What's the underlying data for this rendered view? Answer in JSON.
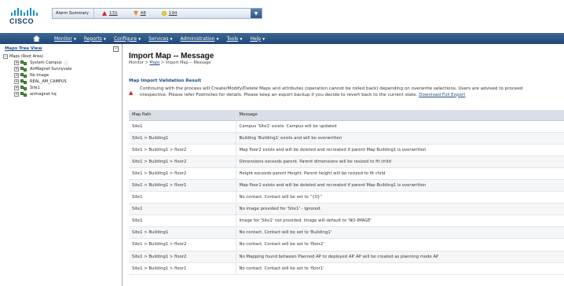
{
  "header": {
    "logo_text": "CISCO",
    "alarm_summary": {
      "label": "Alarm Summary",
      "critical": "131",
      "major": "48",
      "minor": "194"
    }
  },
  "menu": {
    "items": [
      "Monitor",
      "Reports",
      "Configure",
      "Services",
      "Administration",
      "Tools",
      "Help"
    ]
  },
  "sidebar": {
    "title": "Maps Tree View",
    "collapse": "−",
    "root": "Maps (Root Area)",
    "items": [
      {
        "label": "System Campus"
      },
      {
        "label": "AirMagnet Sunnyvale"
      },
      {
        "label": "No Image"
      },
      {
        "label": "REAL_AM_CAMPUS"
      },
      {
        "label": "Site1"
      },
      {
        "label": "airmagnet hq"
      }
    ]
  },
  "main": {
    "title": "Import Map -- Message",
    "breadcrumb": {
      "prefix": "Monitor > ",
      "link": "Maps",
      "suffix": " > Import Map -- Message"
    },
    "section_title": "Map Import Validation Result",
    "warning_line1": "Continuing with the process will Create/Modify/Delete Maps and attributes (operation cannot be rolled back) depending on overwrite selections. Users are advised to proceed",
    "warning_line2": "irrespective. Please refer Footnotes for details. Please keep an export backup if you decide to revert back to the current state.",
    "download_link": "Download Full Export",
    "table": {
      "headers": [
        "Map Path",
        "Message"
      ],
      "rows": [
        [
          "Site1",
          "Campus 'Site1' exists. Campus will be updated"
        ],
        [
          "Site1 > Building1",
          "Building 'Building1' exists and will be overwritten"
        ],
        [
          "Site1 > Building1 > floor2",
          "Map floor2 exists and will be deleted and recreated if parent Map Building1 is overwritten"
        ],
        [
          "Site1 > Building1 > floor2",
          "Dimensions exceeds parent. Parent dimensions will be resized to fit child"
        ],
        [
          "Site1 > Building1 > floor2",
          "Height exceeds parent Height. Parent height will be resized to fit child"
        ],
        [
          "Site1 > Building1 > floor1",
          "Map floor1 exists and will be deleted and recreated if parent Map Building1 is overwritten"
        ],
        [
          "Site1",
          "No contact. Contact will be set to ''{0}''"
        ],
        [
          "Site1",
          "No image provided for 'Site1' - Ignored."
        ],
        [
          "Site1",
          "Image for 'Site1' not provided. Image will default to 'NO-IMAGE'"
        ],
        [
          "Site1 > Building1",
          "No contact. Contact will be set to 'Building1'"
        ],
        [
          "Site1 > Building1 > floor2",
          "No contact. Contact will be set to 'floor2'"
        ],
        [
          "Site1 > Building1 > floor2",
          "No Mapping found between Planned AP to deployed AP. AP will be created as planning mode AP"
        ],
        [
          "Site1 > Building1 > floor1",
          "No contact. Contact will be set to 'floor1'"
        ]
      ]
    }
  }
}
